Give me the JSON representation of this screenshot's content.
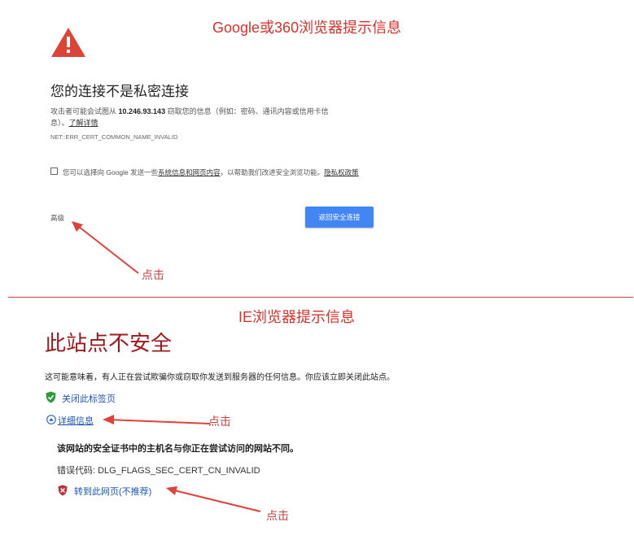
{
  "google_section": {
    "title": "Google或360浏览器提示信息",
    "heading": "您的连接不是私密连接",
    "desc_before_ip": "攻击者可能会试图从 ",
    "ip": "10.246.93.143",
    "desc_after_ip": " 窃取您的信息（例如：密码、通讯内容或信用卡信",
    "desc_line2": "息）。",
    "learn_more": "了解详情",
    "error_code": "NET::ERR_CERT_COMMON_NAME_INVALID",
    "checkbox_text_1": "您可以选择向 Google 发送一些",
    "checkbox_link_1": "系统信息和网页内容",
    "checkbox_text_2": "，以帮助我们改进安全浏览功能。",
    "checkbox_link_2": "隐私权政策",
    "advanced": "高级",
    "back_button": "返回安全连接",
    "click_note": "点击"
  },
  "ie_section": {
    "title": "IE浏览器提示信息",
    "heading": "此站点不安全",
    "desc": "这可能意味着，有人正在尝试欺骗你或窃取你发送到服务器的任何信息。你应该立即关闭此站点。",
    "close_tab": "关闭此标签页",
    "details": "详细信息",
    "details_note": "点击",
    "mismatch": "该网站的安全证书中的主机名与你正在尝试访问的网站不同。",
    "error_code": "错误代码: DLG_FLAGS_SEC_CERT_CN_INVALID",
    "go_on": "转到此网页(不推荐)",
    "go_on_note": "点击"
  },
  "colors": {
    "annotation_red": "#d9312b",
    "ie_heading": "#a0181c",
    "link_blue": "#1a56b8",
    "button_blue": "#4285f4",
    "warning_red": "#db4437"
  },
  "icons": [
    "warning-triangle-icon",
    "green-shield-check-icon",
    "chevron-up-circle-icon",
    "red-shield-x-icon",
    "annotation-arrow-icon"
  ]
}
